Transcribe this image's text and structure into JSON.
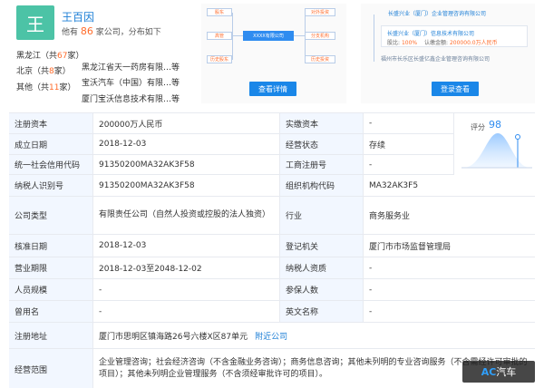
{
  "person": {
    "avatar_char": "王",
    "name": "王百因",
    "count_prefix": "他有",
    "count": "86",
    "count_suffix": "家公司，分布如下"
  },
  "regions": [
    {
      "name": "黑龙江",
      "open": "（共",
      "count": "67",
      "close": "家）"
    },
    {
      "name": "北京",
      "open": "（共",
      "count": "8",
      "close": "家）"
    },
    {
      "name": "其他",
      "open": "（共",
      "count": "11",
      "close": "家）"
    }
  ],
  "companies": [
    "黑龙江省天一药房有限…等",
    "宝沃汽车（中国）有限…等",
    "厦门宝沃信息技术有限…等"
  ],
  "graph_panel": {
    "nodes": [
      "股东",
      "高管",
      "历史股东",
      "XXXX有限公司",
      "对外投资",
      "分支机构",
      "历史投资"
    ],
    "button": "查看详情"
  },
  "tree_panel": {
    "root": "长盛兴业（厦门）企业管理咨询有限公司",
    "child": "长盛兴业（厦门）信息技术有限公司",
    "child_share_label": "股比:",
    "child_share": "100%",
    "child_capital_label": "认缴金额:",
    "child_capital": "200000.0万人民币",
    "sibling": "福州市长乐区长盛亿鑫企业管理咨询有限公司",
    "button": "登录查看"
  },
  "table": {
    "reg_capital_label": "注册资本",
    "reg_capital": "200000万人民币",
    "paid_capital_label": "实缴资本",
    "paid_capital": "-",
    "founded_label": "成立日期",
    "founded": "2018-12-03",
    "status_label": "经营状态",
    "status": "存续",
    "credit_code_label": "统一社会信用代码",
    "credit_code": "91350200MA32AK3F58",
    "biz_reg_label": "工商注册号",
    "biz_reg": "-",
    "taxpayer_label": "纳税人识别号",
    "taxpayer": "91350200MA32AK3F58",
    "org_code_label": "组织机构代码",
    "org_code": "MA32AK3F5",
    "type_label": "公司类型",
    "type": "有限责任公司（自然人投资或控股的法人独资）",
    "industry_label": "行业",
    "industry": "商务服务业",
    "approved_label": "核准日期",
    "approved": "2018-12-03",
    "authority_label": "登记机关",
    "authority": "厦门市市场监督管理局",
    "term_label": "营业期限",
    "term": "2018-12-03至2048-12-02",
    "taxpayer_q_label": "纳税人资质",
    "taxpayer_q": "-",
    "staff_label": "人员规模",
    "staff": "-",
    "insured_label": "参保人数",
    "insured": "-",
    "former_name_label": "曾用名",
    "former_name": "-",
    "en_name_label": "英文名称",
    "en_name": "-",
    "address_label": "注册地址",
    "address": "厦门市思明区镇海路26号六楼X区87单元",
    "address_link": "附近公司",
    "scope_label": "经营范围",
    "scope": "企业管理咨询；社会经济咨询（不含金融业务咨询）；商务信息咨询；其他未列明的专业咨询服务（不含需经许可审批的项目）；其他未列明企业管理服务（不含须经审批许可的项目）。"
  },
  "score": {
    "label": "评分",
    "value": "98",
    "accent": "#2f8cf0"
  },
  "watermark": {
    "brand_a": "AC",
    "brand_b": "汽车"
  }
}
